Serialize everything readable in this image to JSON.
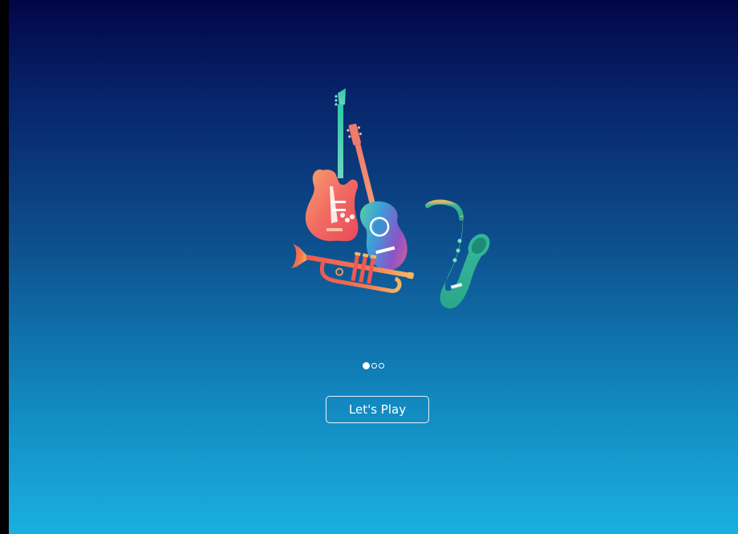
{
  "onboarding": {
    "illustration": {
      "items": [
        "electric-guitar-icon",
        "acoustic-guitar-icon",
        "trumpet-icon",
        "saxophone-icon"
      ]
    },
    "pager": {
      "total": 3,
      "active_index": 0
    },
    "cta_label": "Let's Play"
  },
  "colors": {
    "background_top": "#020547",
    "background_bottom": "#19b0de",
    "button_border": "#e6f3fb",
    "text": "#ffffff"
  }
}
